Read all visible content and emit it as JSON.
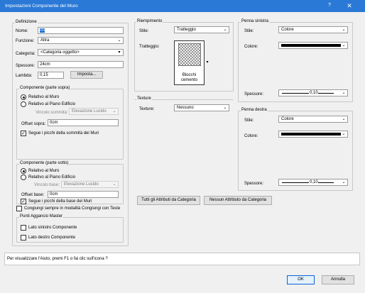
{
  "window": {
    "title": "Impostazioni Componente del Muro",
    "help": "?",
    "close": "✕"
  },
  "definizione": {
    "group_label": "Definizione",
    "nome_label": "Nome:",
    "nome_value": "cls",
    "funzione_label": "Funzione:",
    "funzione_value": "Altra",
    "categoria_label": "Categoria:",
    "categoria_value": "<Categoria oggetto>",
    "spessore_label": "Spessore:",
    "spessore_value": "24cm",
    "lambda_label": "Lambda:",
    "lambda_value": "0,15",
    "imposta_button": "Imposta..."
  },
  "sopra": {
    "group_label": "Componente (parte sopra)",
    "radio1": "Relativo al Muro",
    "radio2": "Relativo al Piano Edificio",
    "vincolo_label": "Vincolo sommità:",
    "vincolo_value": "Elevazione Lucido",
    "offset_label": "Offset sopra:",
    "offset_value": "0cm",
    "segui": "Segue i picchi della sommità dei Muri"
  },
  "sotto": {
    "group_label": "Componente (parte sotto)",
    "radio1": "Relativo al Muro",
    "radio2": "Relativo al Piano Edificio",
    "vincolo_label": "Vincolo base:",
    "vincolo_value": "Elevazione Lucido",
    "offset_label": "Offset base:",
    "offset_value": "0cm",
    "segui": "Segue i picchi della base dei Muri"
  },
  "congiungi": "Congiungi sempre in modalità Congiungi con Teste",
  "punti": {
    "group_label": "Punti Aggancio Master",
    "sinistro": "Lato sinistro Componente",
    "destro": "Lato destro Componente"
  },
  "riempimento": {
    "group_label": "Riempimento",
    "stile_label": "Stile:",
    "stile_value": "Tratteggio",
    "tratteggio_label": "Tratteggio:",
    "hatch_name": "Blocchi cemento"
  },
  "texture": {
    "group_label": "Texture",
    "label": "Texture:",
    "value": "Nessuno"
  },
  "buttons": {
    "tutti": "Tutti gli Attributi da Categoria",
    "nessun": "Nessun Attributo da Categoria",
    "ok": "OK",
    "annulla": "Annulla"
  },
  "penna_sinistra": {
    "group_label": "Penna sinistra",
    "stile_label": "Stile:",
    "stile_value": "Colore",
    "colore_label": "Colore:",
    "colore_hex": "#000000",
    "spessore_label": "Spessore:",
    "spessore_value": "0,10"
  },
  "penna_destra": {
    "group_label": "Penna destra",
    "stile_label": "Stile:",
    "stile_value": "Colore",
    "colore_label": "Colore:",
    "colore_hex": "#000000",
    "spessore_label": "Spessore:",
    "spessore_value": "0,10"
  },
  "status": "Per visualizzare l'Aiuto, premi F1 o fai clic sull'icona ?"
}
